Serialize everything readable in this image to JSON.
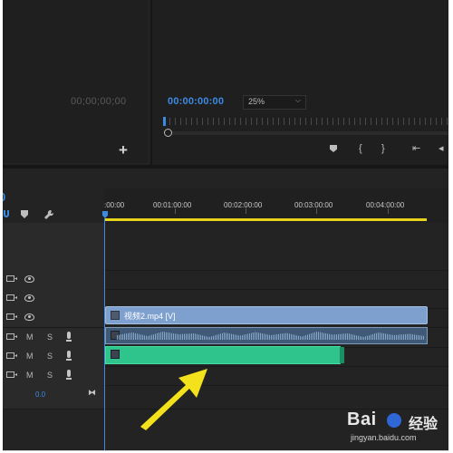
{
  "source_monitor": {
    "timecode": "00;00;00;00",
    "add_button_glyph": "+"
  },
  "program_monitor": {
    "timecode": "00:00:00:00",
    "zoom": {
      "value": "25%",
      "chevron": "⌵"
    },
    "transport": {
      "marker_icon": "marker-icon",
      "mark_in": "{",
      "mark_out": "}",
      "go_to_in": "⇤",
      "step_back": "◂"
    }
  },
  "timeline": {
    "timecode": "0",
    "tools": {
      "snap_icon": "snap-icon",
      "marker_icon": "marker-icon",
      "wrench_icon": "wrench-icon"
    },
    "ruler_labels": [
      ":00:00",
      "00:01:00:00",
      "00:02:00:00",
      "00:03:00:00",
      "00:04:00:00"
    ],
    "tracks": [
      {
        "type": "video",
        "controls": [
          "film-icon",
          "eye-icon"
        ]
      },
      {
        "type": "video",
        "controls": [
          "film-icon",
          "eye-icon"
        ]
      },
      {
        "type": "video",
        "controls": [
          "film-icon",
          "eye-icon"
        ]
      },
      {
        "type": "audio",
        "mute": "M",
        "solo": "S",
        "controls": [
          "film-icon",
          "mic-icon"
        ]
      },
      {
        "type": "audio",
        "mute": "M",
        "solo": "S",
        "controls": [
          "film-icon",
          "mic-icon"
        ]
      },
      {
        "type": "audio",
        "mute": "M",
        "solo": "S",
        "controls": [
          "film-icon",
          "mic-icon"
        ]
      }
    ],
    "clips": {
      "video_clip_name": "视频2.mp4 [V]"
    },
    "master_volume": "0.0",
    "end_icon": "⧓"
  },
  "colors": {
    "accent_blue": "#3c8ae1",
    "work_area": "#e7d21c",
    "video_clip": "#7ea0cf",
    "audio_clip": "#3f5976",
    "audio_clip_selected": "#2fc48c",
    "arrow": "#f3e21b"
  },
  "watermark": {
    "brand": "Bai",
    "brand_suffix": "经验",
    "url": "jingyan.baidu.com"
  }
}
